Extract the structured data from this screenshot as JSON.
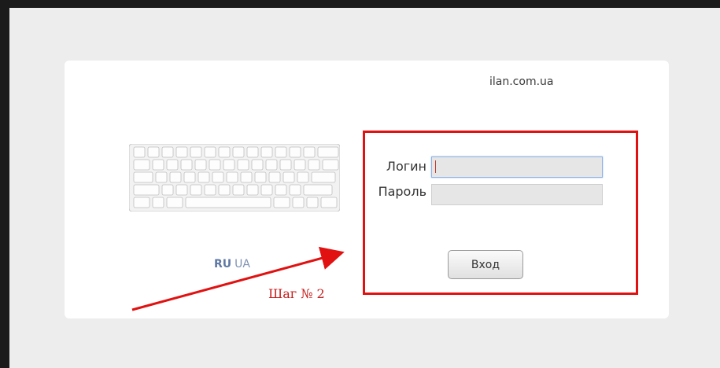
{
  "site_name": "ilan.com.ua",
  "keyboard_icon": "keyboard-icon",
  "languages": {
    "ru": "RU",
    "ua": "UA"
  },
  "form": {
    "login_label": "Логин",
    "login_value": "",
    "password_label": "Пароль",
    "password_value": "",
    "submit_label": "Вход"
  },
  "annotation": {
    "step_text": "Шаг № 2",
    "color": "#e11111"
  }
}
